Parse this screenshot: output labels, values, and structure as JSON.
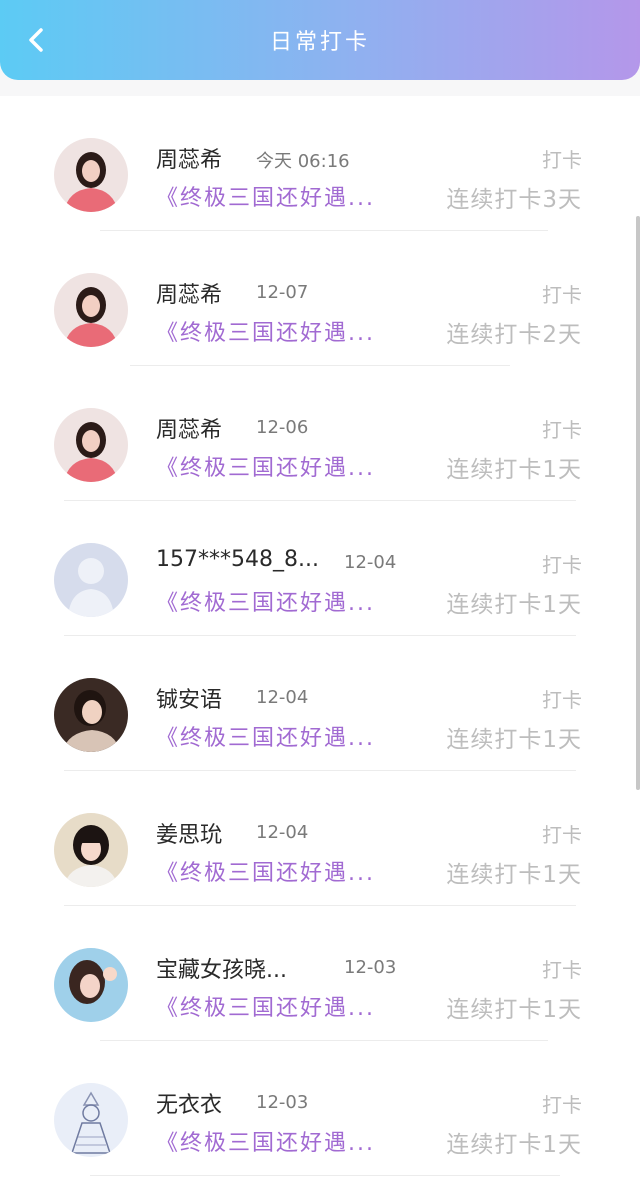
{
  "header": {
    "title": "日常打卡"
  },
  "items": [
    {
      "name": "周蕊希",
      "date": "今天 06:16",
      "action": "打卡",
      "book": "《终极三国还好遇...",
      "streak": "连续打卡3天",
      "avatar": "photo-girl-pink"
    },
    {
      "name": "周蕊希",
      "date": "12-07",
      "action": "打卡",
      "book": "《终极三国还好遇...",
      "streak": "连续打卡2天",
      "avatar": "photo-girl-pink"
    },
    {
      "name": "周蕊希",
      "date": "12-06",
      "action": "打卡",
      "book": "《终极三国还好遇...",
      "streak": "连续打卡1天",
      "avatar": "photo-girl-pink"
    },
    {
      "name": "157***548_8...",
      "date": "12-04",
      "action": "打卡",
      "book": "《终极三国还好遇...",
      "streak": "连续打卡1天",
      "avatar": "default-user"
    },
    {
      "name": "铖安语",
      "date": "12-04",
      "action": "打卡",
      "book": "《终极三国还好遇...",
      "streak": "连续打卡1天",
      "avatar": "photo-girl-dark"
    },
    {
      "name": "姜思玧",
      "date": "12-04",
      "action": "打卡",
      "book": "《终极三国还好遇...",
      "streak": "连续打卡1天",
      "avatar": "photo-girl-bangs"
    },
    {
      "name": "宝藏女孩晓...",
      "date": "12-03",
      "action": "打卡",
      "book": "《终极三国还好遇...",
      "streak": "连续打卡1天",
      "avatar": "photo-girl-blue"
    },
    {
      "name": "无衣衣",
      "date": "12-03",
      "action": "打卡",
      "book": "《终极三国还好遇...",
      "streak": "连续打卡1天",
      "avatar": "illustration-sketch"
    }
  ]
}
